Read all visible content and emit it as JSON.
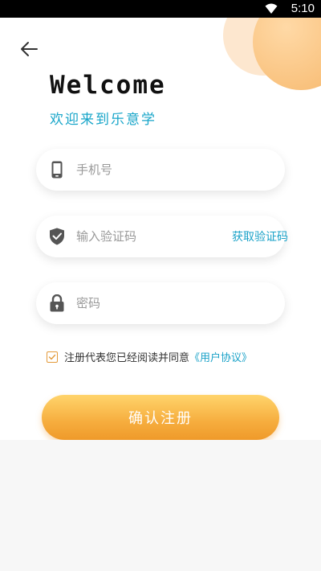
{
  "status_bar": {
    "time": "5:10"
  },
  "header": {
    "title": "Welcome",
    "subtitle": "欢迎来到乐意学"
  },
  "form": {
    "phone": {
      "placeholder": "手机号",
      "value": ""
    },
    "code": {
      "placeholder": "输入验证码",
      "value": "",
      "get_code_label": "获取验证码"
    },
    "password": {
      "placeholder": "密码",
      "value": ""
    },
    "agreement": {
      "checked": true,
      "text": "注册代表您已经阅读并同意",
      "link": "《用户协议》"
    },
    "submit_label": "确认注册"
  },
  "colors": {
    "accent_blue": "#1aa2c8",
    "button_orange": "#f6ad3e",
    "decor_orange": "#f9c27e",
    "icon_gray": "#555555"
  },
  "icons": {
    "back": "arrow-left-icon",
    "phone": "phone-icon",
    "code": "shield-check-icon",
    "password": "lock-icon"
  }
}
